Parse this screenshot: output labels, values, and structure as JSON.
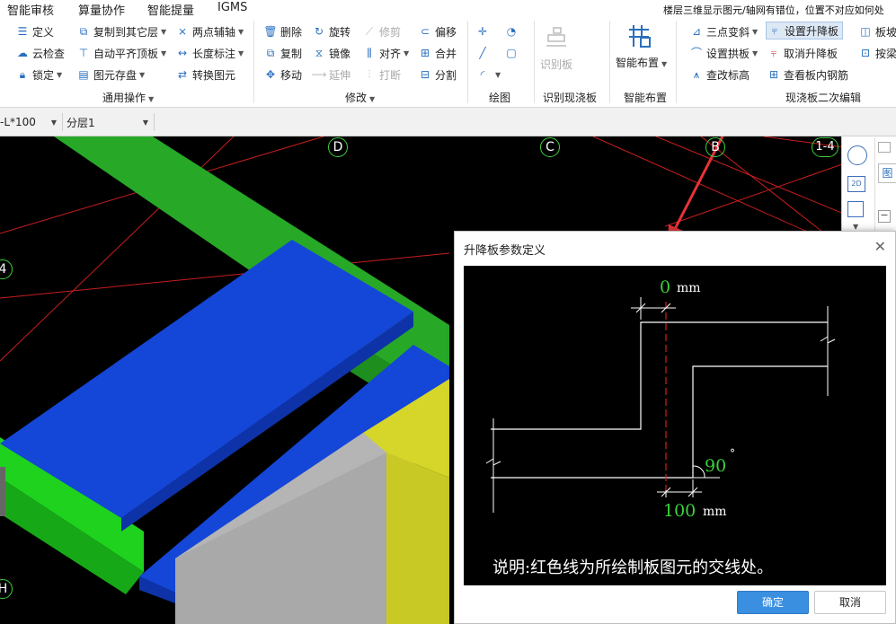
{
  "menubar": {
    "items": [
      "智能审核",
      "算量协作",
      "智能提量",
      "IGMS"
    ],
    "notice": "楼层三维显示图元/轴网有错位，位置不对应如何处"
  },
  "ribbon": {
    "groups": {
      "general": "通用操作",
      "modify": "修改",
      "draw": "绘图",
      "identify": "识别现浇板",
      "smart": "智能布置",
      "edit2": "现浇板二次编辑"
    },
    "general": {
      "define": "定义",
      "cloud_check": "云检查",
      "lock": "锁定",
      "copy_to_floor": "复制到其它层",
      "auto_align_top": "自动平齐顶板",
      "element_storage": "图元存盘",
      "two_point_axis": "两点辅轴",
      "dimension": "长度标注",
      "convert_element": "转换图元"
    },
    "modify": {
      "delete": "删除",
      "copy": "复制",
      "move": "移动",
      "rotate": "旋转",
      "mirror": "镜像",
      "extend": "延伸",
      "trim": "修剪",
      "align": "对齐",
      "break": "打断",
      "offset": "偏移",
      "merge": "合并",
      "split": "分割"
    },
    "identify": {
      "label": "识别板"
    },
    "smart": {
      "label": "智能布置"
    },
    "edit2": {
      "three_point_slope": "三点变斜",
      "set_arch": "设置拱板",
      "check_elevation": "查改标高",
      "set_raise": "设置升降板",
      "cancel_raise": "取消升降板",
      "view_rebar": "查看板内钢筋",
      "slab_hole": "板坡",
      "press_beam": "按梁"
    }
  },
  "toolbar": {
    "combo1": "-L*100",
    "combo2": "分层1"
  },
  "viewport": {
    "axes": {
      "D": "D",
      "C": "C",
      "B": "B",
      "r14": "1-4",
      "left4": "4",
      "H": "H"
    }
  },
  "sidepanel": {
    "btn_2d": "2D",
    "tab": "图"
  },
  "dialog": {
    "title": "升降板参数定义",
    "top_value": "0",
    "top_unit": "mm",
    "angle_value": "90",
    "angle_unit": "°",
    "bottom_value": "100",
    "bottom_unit": "mm",
    "note": "说明:红色线为所绘制板图元的交线处。",
    "ok": "确定",
    "cancel": "取消"
  },
  "colors": {
    "beam_green": "#27a827",
    "slab_blue": "#1446d8",
    "column_gray": "#b5b5b5",
    "column_yellow": "#d6d62a",
    "axis_circle": "#3bd23b",
    "grid_red": "#c81e1e",
    "dim_green": "#3bd23b",
    "arrow_red": "#e6333a",
    "ok_blue": "#3b8fe0"
  }
}
